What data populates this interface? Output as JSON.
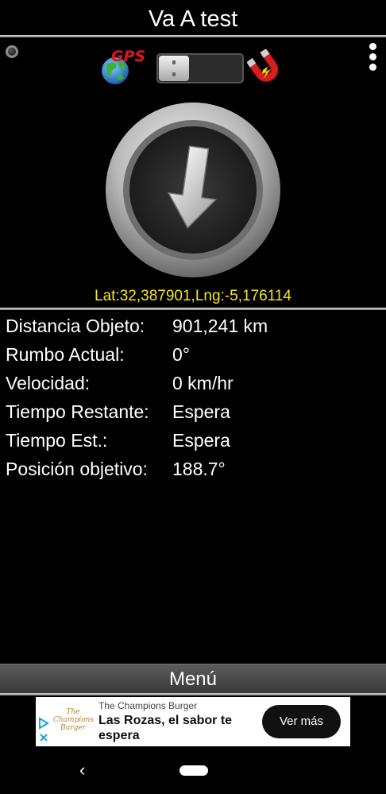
{
  "app": {
    "title": "Va A test"
  },
  "toolbar": {
    "gps_label": "GPS",
    "gps_enabled": false
  },
  "compass": {
    "heading_icon": "arrow-down-icon"
  },
  "location": {
    "coords": "Lat:32,387901,Lng:-5,176114"
  },
  "info": [
    {
      "label": "Distancia Objeto:",
      "value": "901,241 km"
    },
    {
      "label": "Rumbo Actual:",
      "value": "0°"
    },
    {
      "label": "Velocidad:",
      "value": "0 km/hr"
    },
    {
      "label": "Tiempo Restante:",
      "value": "Espera"
    },
    {
      "label": "Tiempo Est.:",
      "value": "Espera"
    },
    {
      "label": "Posición objetivo:",
      "value": "188.7°"
    }
  ],
  "menu": {
    "label": "Menú"
  },
  "ad": {
    "logo_text": "The Champions Burger",
    "sponsor": "The Champions Burger",
    "headline": "Las Rozas, el sabor te espera",
    "cta": "Ver más"
  },
  "colors": {
    "coords": "#f6e51a",
    "background": "#000000"
  }
}
